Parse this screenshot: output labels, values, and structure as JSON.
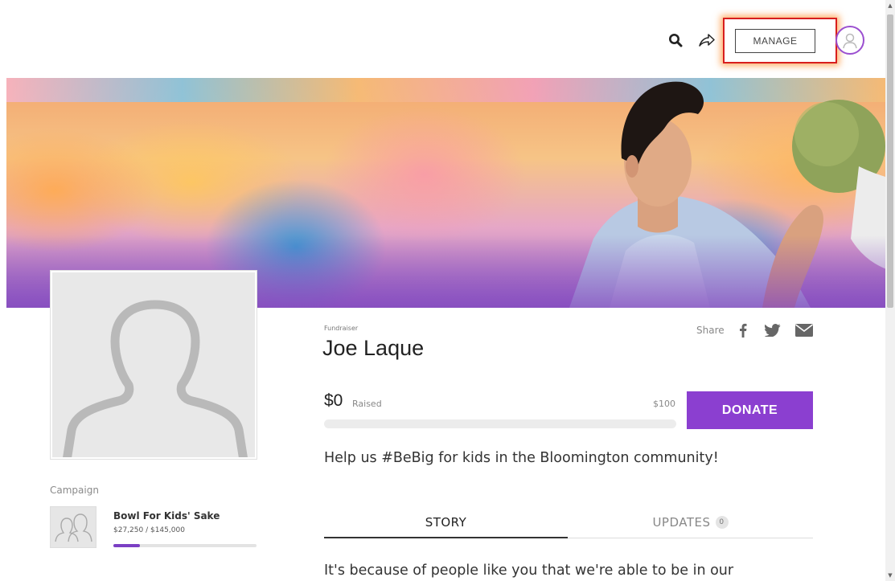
{
  "header": {
    "manage_label": "MANAGE"
  },
  "fundraiser": {
    "type_label": "Fundraiser",
    "name": "Joe Laque",
    "share_label": "Share",
    "raised_amount": "$0",
    "raised_label": "Raised",
    "goal_amount": "$100",
    "progress_fraction": 0,
    "donate_label": "DONATE",
    "tagline": "Help us #BeBig for kids in the Bloomington community!"
  },
  "campaign": {
    "section_label": "Campaign",
    "name": "Bowl For Kids' Sake",
    "amount_text": "$27,250 / $145,000",
    "progress_fraction": 0.188
  },
  "tabs": {
    "story_label": "STORY",
    "updates_label": "UPDATES",
    "updates_count": "0"
  },
  "story": {
    "text": "It's because of people like you that we're able to be in our"
  },
  "icons": {
    "search": "search-icon",
    "share": "share-arrow-icon",
    "avatar": "user-avatar-icon",
    "facebook": "facebook-icon",
    "twitter": "twitter-icon",
    "email": "email-icon",
    "profile_placeholder": "person-silhouette-icon",
    "campaign_placeholder": "group-icon"
  },
  "colors": {
    "accent": "#8b3fd0",
    "highlight_border": "#d81e1e"
  }
}
